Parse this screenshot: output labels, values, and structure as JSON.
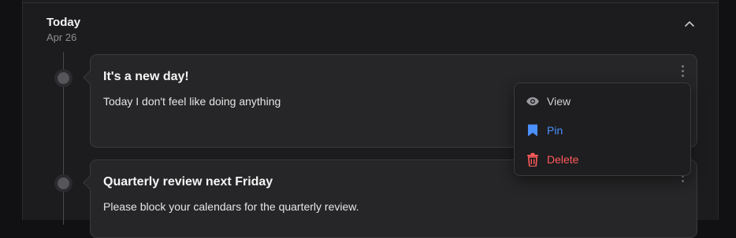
{
  "day": {
    "title": "Today",
    "date": "Apr 26"
  },
  "entries": [
    {
      "title": "It's a new day!",
      "body": "Today I don't feel like doing anything"
    },
    {
      "title": "Quarterly review next Friday",
      "body": "Please block your calendars for the quarterly review."
    }
  ],
  "menu": {
    "items": [
      {
        "label": "View",
        "icon": "eye-icon",
        "color": "#d0d0d4"
      },
      {
        "label": "Pin",
        "icon": "bookmark-icon",
        "color": "#4a90ff"
      },
      {
        "label": "Delete",
        "icon": "trash-icon",
        "color": "#ff5a5a"
      }
    ]
  },
  "colors": {
    "background": "#1c1c1e",
    "card": "#262628",
    "menu": "#1e1e20",
    "accent_blue": "#4a90ff",
    "danger_red": "#ff5a5a"
  }
}
